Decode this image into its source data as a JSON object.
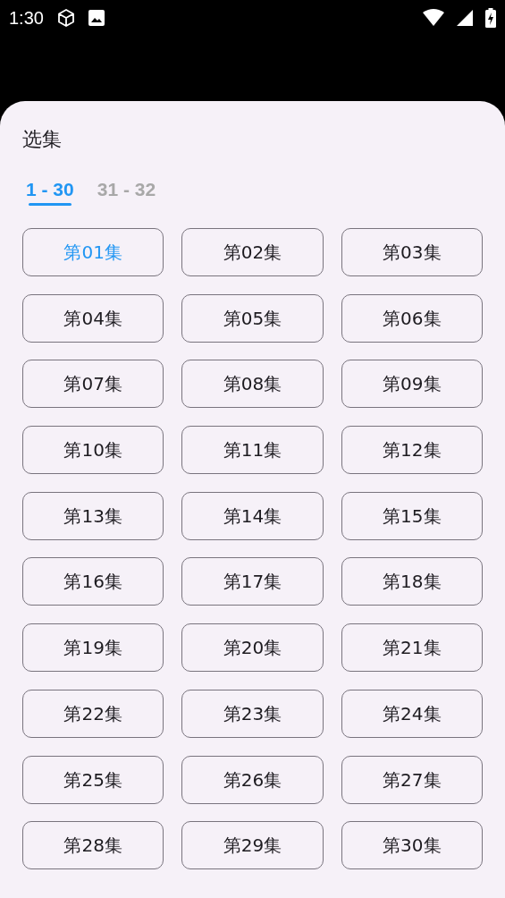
{
  "status_bar": {
    "time": "1:30"
  },
  "sheet": {
    "title": "选集",
    "tabs": [
      {
        "label": "1 - 30",
        "selected": true
      },
      {
        "label": "31 - 32",
        "selected": false
      }
    ],
    "episodes": [
      {
        "label": "第01集",
        "selected": true
      },
      {
        "label": "第02集",
        "selected": false
      },
      {
        "label": "第03集",
        "selected": false
      },
      {
        "label": "第04集",
        "selected": false
      },
      {
        "label": "第05集",
        "selected": false
      },
      {
        "label": "第06集",
        "selected": false
      },
      {
        "label": "第07集",
        "selected": false
      },
      {
        "label": "第08集",
        "selected": false
      },
      {
        "label": "第09集",
        "selected": false
      },
      {
        "label": "第10集",
        "selected": false
      },
      {
        "label": "第11集",
        "selected": false
      },
      {
        "label": "第12集",
        "selected": false
      },
      {
        "label": "第13集",
        "selected": false
      },
      {
        "label": "第14集",
        "selected": false
      },
      {
        "label": "第15集",
        "selected": false
      },
      {
        "label": "第16集",
        "selected": false
      },
      {
        "label": "第17集",
        "selected": false
      },
      {
        "label": "第18集",
        "selected": false
      },
      {
        "label": "第19集",
        "selected": false
      },
      {
        "label": "第20集",
        "selected": false
      },
      {
        "label": "第21集",
        "selected": false
      },
      {
        "label": "第22集",
        "selected": false
      },
      {
        "label": "第23集",
        "selected": false
      },
      {
        "label": "第24集",
        "selected": false
      },
      {
        "label": "第25集",
        "selected": false
      },
      {
        "label": "第26集",
        "selected": false
      },
      {
        "label": "第27集",
        "selected": false
      },
      {
        "label": "第28集",
        "selected": false
      },
      {
        "label": "第29集",
        "selected": false
      },
      {
        "label": "第30集",
        "selected": false
      }
    ]
  }
}
